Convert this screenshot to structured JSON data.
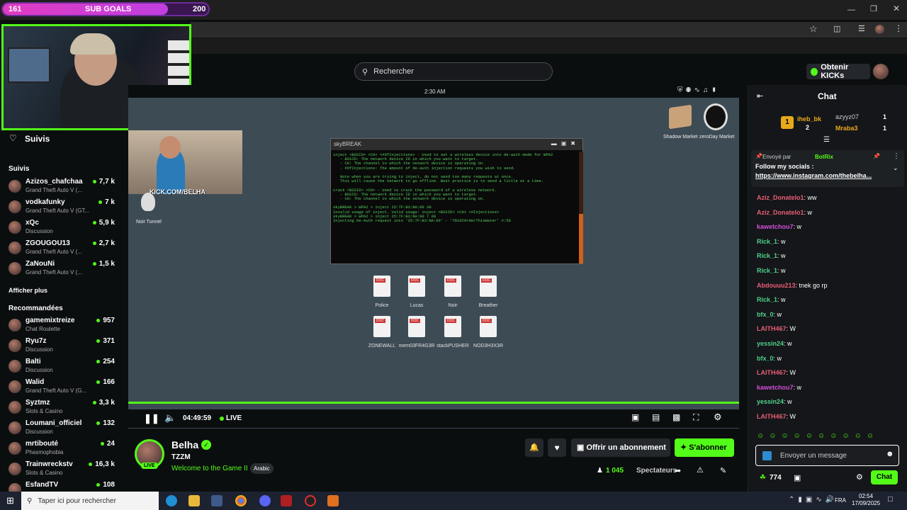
{
  "goals": {
    "current": "161",
    "label": "SUB GOALS",
    "target": "200",
    "progress_fraction": 0.805
  },
  "search": {
    "placeholder": "Rechercher"
  },
  "header": {
    "get_kicks": "Obtenir KICKs"
  },
  "sidebar": {
    "following_nav": "Suivis",
    "following_title": "Suivis",
    "show_more": "Afficher plus",
    "recommended_title": "Recommandées",
    "following": [
      {
        "name": "Azizos_chafchaa",
        "category": "Grand Theft Auto V (...",
        "viewers": "7,7 k"
      },
      {
        "name": "vodkafunky",
        "category": "Grand Theft Auto V (GT...",
        "viewers": "7 k"
      },
      {
        "name": "xQc",
        "category": "Discussion",
        "viewers": "5,9 k"
      },
      {
        "name": "ZGOUGOU13",
        "category": "Grand Theft Auto V (...",
        "viewers": "2,7 k"
      },
      {
        "name": "ZaNouNi",
        "category": "Grand Theft Auto V (...",
        "viewers": "1,5 k"
      }
    ],
    "recommended": [
      {
        "name": "gamemixtreize",
        "category": "Chat Roulette",
        "viewers": "957"
      },
      {
        "name": "Ryu7z",
        "category": "Discussion",
        "viewers": "371"
      },
      {
        "name": "Balti",
        "category": "Discussion",
        "viewers": "254"
      },
      {
        "name": "Walid",
        "category": "Grand Theft Auto V (G...",
        "viewers": "166"
      },
      {
        "name": "Syztmz",
        "category": "Slots & Casino",
        "viewers": "3,3 k"
      },
      {
        "name": "Loumani_officiel",
        "category": "Discussion",
        "viewers": "132"
      },
      {
        "name": "mrtibouté",
        "category": "Phasmophobia",
        "viewers": "24"
      },
      {
        "name": "Trainwreckstv",
        "category": "Slots & Casino",
        "viewers": "16,3 k"
      },
      {
        "name": "EsfandTV",
        "category": "",
        "viewers": "108"
      }
    ]
  },
  "game": {
    "clock": "2:30 AM",
    "icon_shadow": "Shadow Market",
    "icon_zeroday": "zeroDay Market",
    "icon_noir": "Noir Tunnel",
    "kick_overlay": "KICK.COM/BELHA",
    "terminal_title": "skyBREAK",
    "terminal_text": "inject <BSSID> <CH> <#OfInjections> - Used to set a wireless device into de-auth mode for WPA2\n   - BSSID: The network device ID in which you want to target.\n   - CH: The channel in which the network device is operating on.\n   - #OfInjections: The amount of de-auth injection requests you wish to send.\n\n   Note when you are trying to inject, do not send too many requests at once.\n   This will cause the network to go offline. Best practice is to send a little at a time.\n\ncrack <BSSID> <CH> - Used to crack the password of a wireless network.\n   - BSSID: The network device ID in which you want to target.\n   - CH: The channel in which the network device is operating on.\n\nskyBREAK > WPA2 > inject 25:7F:B3:NA:00 30\nInvalid usage of inject. Valid usage: inject <BSSID> <CH> <#Injections>\nskyBREAK > WPA2 > inject 25:7F:B3:NA:00 7 60\nInjecting De-Auth request into '25:7F:B3:NA:00' - 'YDidIOrderThisWater' #:50",
    "docs": [
      "Police",
      "Lucas",
      "Noir",
      "Breather",
      "ZONEWALL",
      "mem03FR4G3R",
      "stackPUSHER",
      "NOD3H3X3R"
    ]
  },
  "player": {
    "time": "04:49:59",
    "live": "LIVE"
  },
  "streamer": {
    "name": "Belha",
    "live_badge": "LIVE",
    "category": "TZZM",
    "title": "Welcome to the Game II",
    "language": "Arabic",
    "subscribe_gift": "Offrir un abonnement",
    "subscribe": "S'abonner",
    "viewers": "1 045",
    "viewers_label": "Spectateurs"
  },
  "chat": {
    "title": "Chat",
    "top_rank": "1",
    "top1_name": "iheb_bk",
    "top1_count": "2",
    "top2_name": "azyyz07",
    "top2_count": "1",
    "top3_name": "Mraba3",
    "top3_count": "1",
    "pinned_by_label": "Envoyé par",
    "pinned_by": "BotRix",
    "pinned_text": "Follow my socials :",
    "pinned_link": "https://www.instagram.com/thebelha...",
    "messages": [
      {
        "user": "Aziz_Donatelo1",
        "text": "ww",
        "color": "#e85d75"
      },
      {
        "user": "Aziz_Donatelo1",
        "text": "w",
        "color": "#e85d75"
      },
      {
        "user": "kawetchou7",
        "text": "w",
        "color": "#d04fd8"
      },
      {
        "user": "Rick_1",
        "text": "w",
        "color": "#4fd18b"
      },
      {
        "user": "Rick_1",
        "text": "w",
        "color": "#4fd18b"
      },
      {
        "user": "Rick_1",
        "text": "w",
        "color": "#4fd18b"
      },
      {
        "user": "Abdouuu213",
        "text": "tnek go rp",
        "color": "#e85d75"
      },
      {
        "user": "Rick_1",
        "text": "w",
        "color": "#4fd18b"
      },
      {
        "user": "bfx_0",
        "text": "w",
        "color": "#4fd18b"
      },
      {
        "user": "LAITH467",
        "text": "W",
        "color": "#e85d75"
      },
      {
        "user": "yessin24",
        "text": "w",
        "color": "#4fd18b"
      },
      {
        "user": "bfx_0",
        "text": "w",
        "color": "#4fd18b"
      },
      {
        "user": "LAITH467",
        "text": "W",
        "color": "#e85d75"
      },
      {
        "user": "kawetchou7",
        "text": "w",
        "color": "#d04fd8"
      },
      {
        "user": "yessin24",
        "text": "w",
        "color": "#4fd18b"
      },
      {
        "user": "LAITH467",
        "text": "W",
        "color": "#e85d75"
      }
    ],
    "input_placeholder": "Envoyer un message",
    "points": "774",
    "send": "Chat"
  },
  "taskbar": {
    "search": "Taper ici pour rechercher",
    "lang": "FRA",
    "time": "02:54",
    "date": "17/09/2025"
  },
  "colors": {
    "accent": "#53fc18",
    "background": "#0b0e0f",
    "goal_fill": "#e03cc1"
  }
}
